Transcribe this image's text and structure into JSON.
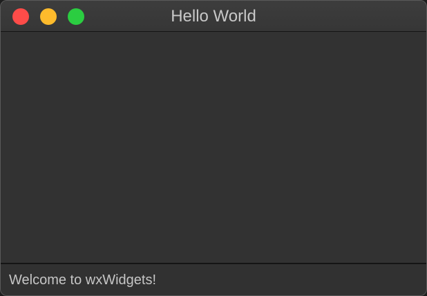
{
  "window": {
    "title": "Hello World",
    "controls": {
      "close": "close-button",
      "minimize": "minimize-button",
      "zoom": "zoom-button"
    }
  },
  "statusbar": {
    "text": "Welcome to wxWidgets!"
  },
  "colors": {
    "close": "#fe4c49",
    "minimize": "#febb2c",
    "zoom": "#2bcd41",
    "background": "#323232"
  }
}
